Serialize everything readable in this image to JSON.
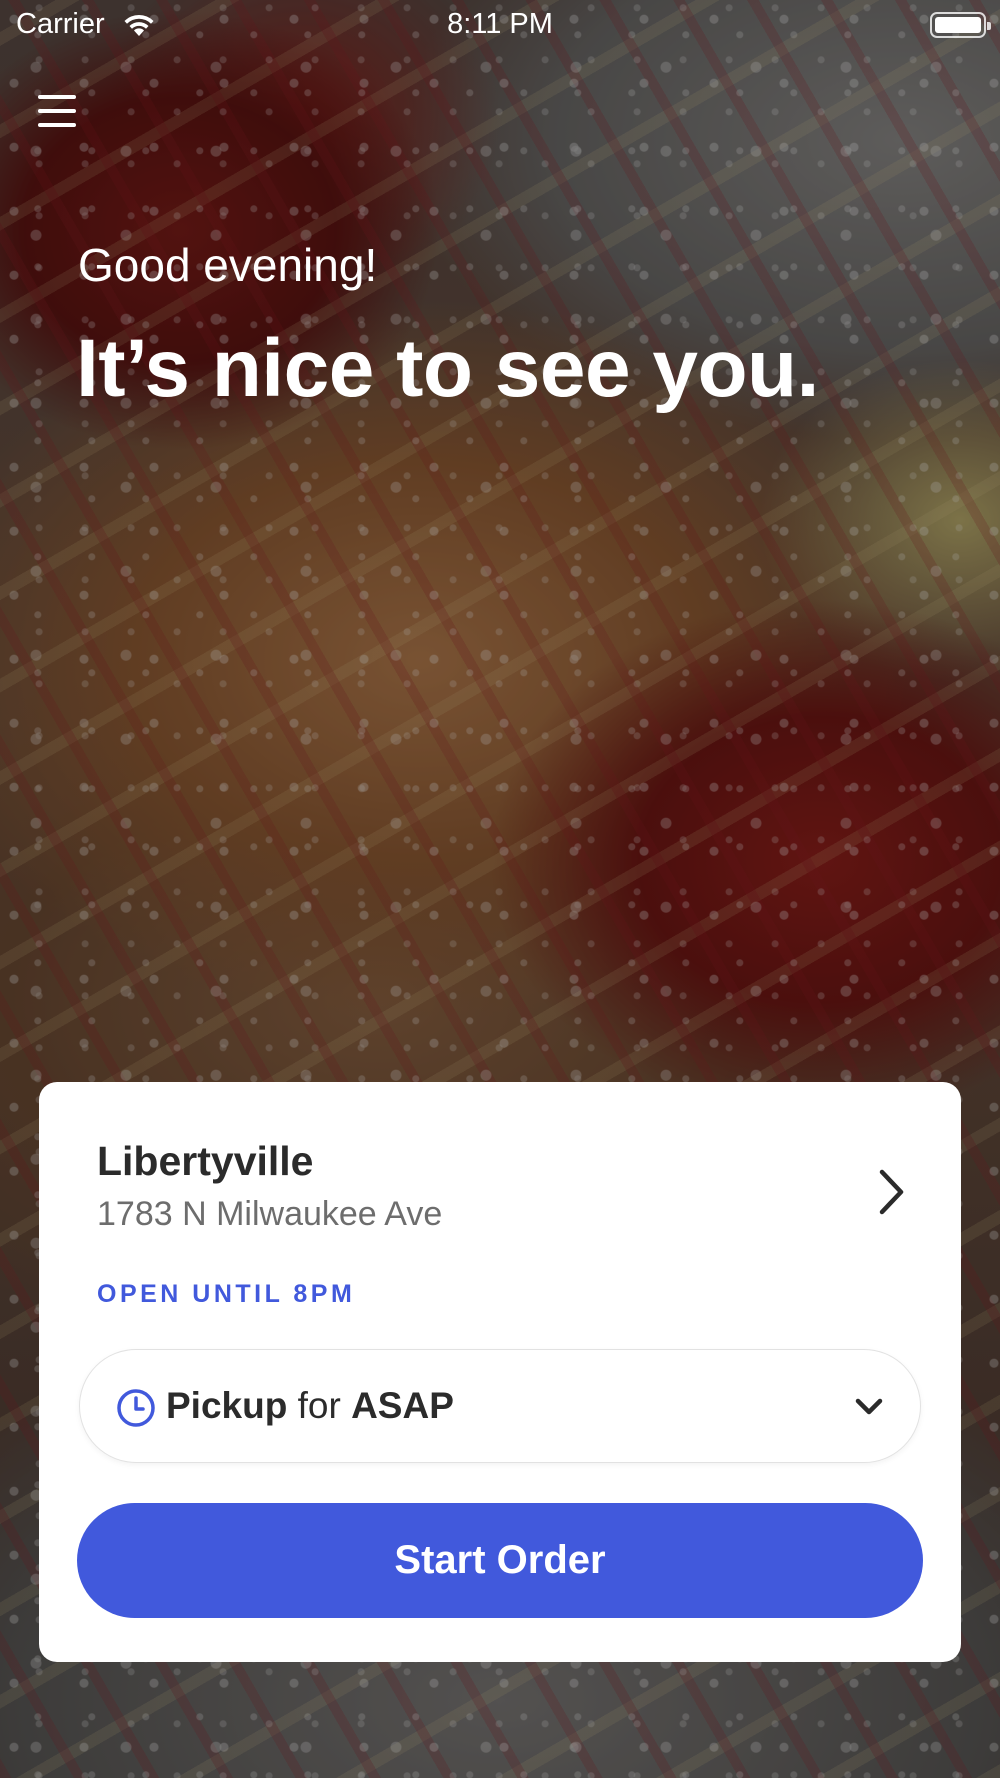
{
  "status_bar": {
    "carrier": "Carrier",
    "time": "8:11 PM"
  },
  "hero": {
    "greeting": "Good evening!",
    "headline": "It’s nice to see you."
  },
  "location": {
    "name": "Libertyville",
    "address": "1783 N Milwaukee Ave",
    "hours": "OPEN UNTIL 8PM"
  },
  "order_mode": {
    "mode": "Pickup",
    "connector": "for",
    "time": "ASAP"
  },
  "actions": {
    "start_order": "Start Order"
  },
  "colors": {
    "accent": "#4159dc",
    "text_dark": "#2b2b2b",
    "text_muted": "#6d6d6d"
  },
  "icons": [
    "wifi-icon",
    "battery-icon",
    "menu-icon",
    "chevron-right-icon",
    "clock-icon",
    "chevron-down-icon"
  ]
}
